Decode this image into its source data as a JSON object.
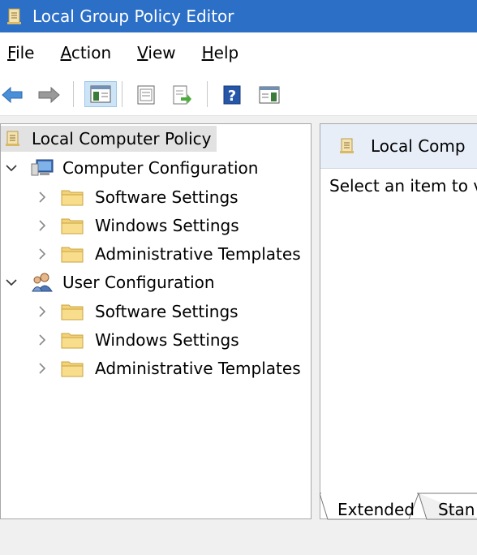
{
  "window": {
    "title": "Local Group Policy Editor"
  },
  "menu": [
    {
      "key": "F",
      "rest": "ile"
    },
    {
      "key": "A",
      "rest": "ction"
    },
    {
      "key": "V",
      "rest": "iew"
    },
    {
      "key": "H",
      "rest": "elp"
    }
  ],
  "toolbar": {
    "buttons": [
      "back-icon",
      "forward-icon",
      "show-hide-tree-icon",
      "properties-icon",
      "export-list-icon",
      "help-icon",
      "show-hide-action-pane-icon"
    ]
  },
  "tree": {
    "root": "Local Computer Policy",
    "computer": {
      "label": "Computer Configuration",
      "children": [
        "Software Settings",
        "Windows Settings",
        "Administrative Templates"
      ]
    },
    "user": {
      "label": "User Configuration",
      "children": [
        "Software Settings",
        "Windows Settings",
        "Administrative Templates"
      ]
    }
  },
  "details": {
    "header": "Local Comp",
    "body": "Select an item to v"
  },
  "tabs": [
    "Extended",
    "Stan"
  ],
  "colors": {
    "titlebar": "#2b6fc7",
    "folder": "#f3d27a",
    "selection": "#e2e2e2"
  }
}
